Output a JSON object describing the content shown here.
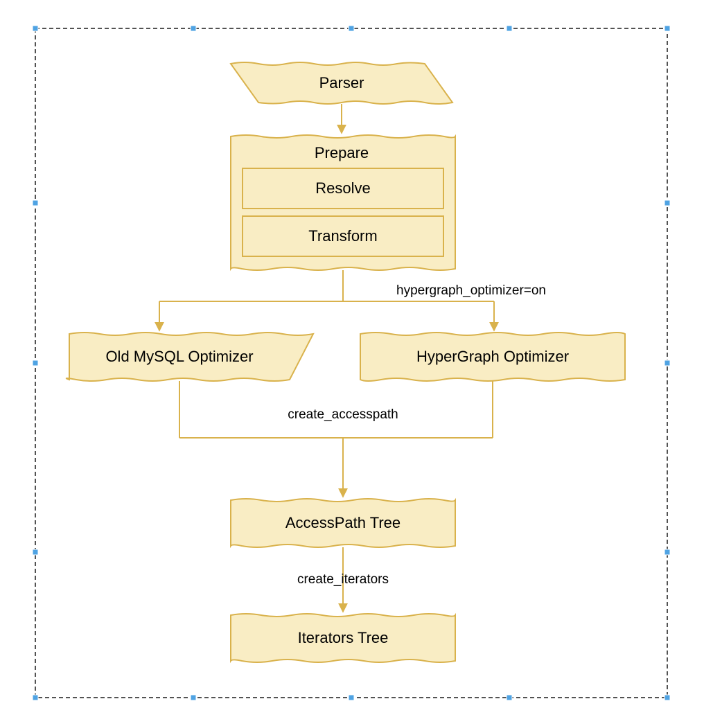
{
  "colors": {
    "boxFill": "#f9edc4",
    "boxStroke": "#d9b24c",
    "connector": "#d9b24c",
    "selection": "#1a1a1a",
    "handle": "#4fa3e3"
  },
  "nodes": {
    "parser": "Parser",
    "prepare": "Prepare",
    "resolve": "Resolve",
    "transform": "Transform",
    "oldOptimizer": "Old MySQL Optimizer",
    "hyperOptimizer": "HyperGraph Optimizer",
    "accessPath": "AccessPath Tree",
    "iterators": "Iterators Tree"
  },
  "edgeLabels": {
    "hypergraphOn": "hypergraph_optimizer=on",
    "createAccesspath": "create_accesspath",
    "createIterators": "create_iterators"
  }
}
